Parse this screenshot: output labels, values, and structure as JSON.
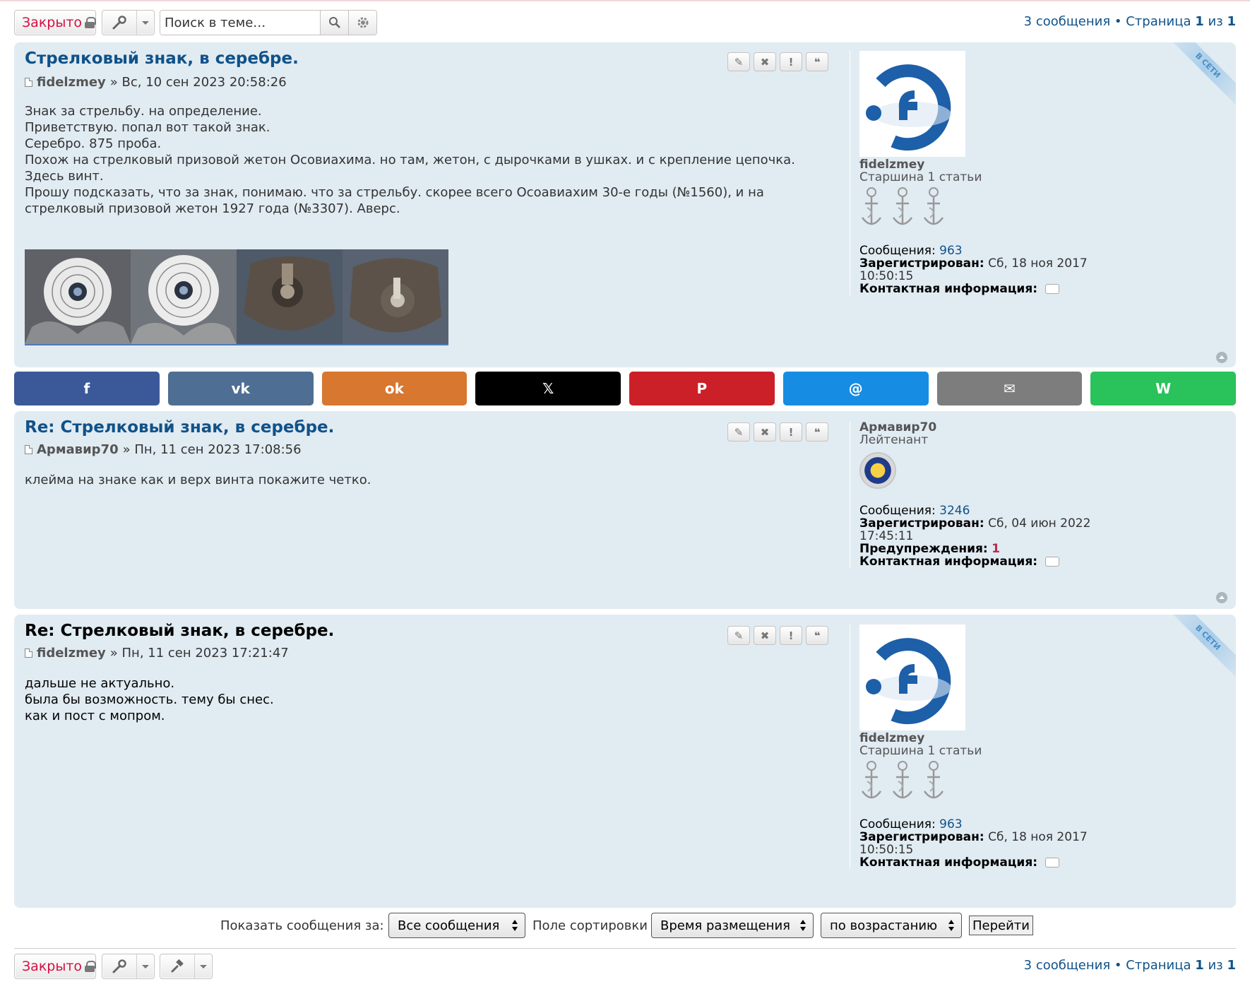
{
  "toolbar": {
    "locked_label": "Закрыто",
    "search_placeholder": "Поиск в теме…",
    "pagination": {
      "count_text": "3 сообщения • Страница ",
      "current": "1",
      "of": " из ",
      "total": "1"
    }
  },
  "posts": [
    {
      "title": "Стрелковый знак, в серебре.",
      "author": "fidelzmey",
      "date": " » Вс, 10 сен 2023 20:58:26",
      "body": [
        "Знак за стрельбу. на определение.",
        "Приветствую. попал вот такой знак.",
        "Серебро. 875 проба.",
        "Похож на стрелковый призовой жетон Осовиахима. но там, жетон, с дырочками в ушках. и с крепление цепочка.",
        "Здесь винт.",
        "Прошу подсказать, что за знак, понимаю. что за стрельбу. скорее всего Осоавиахим 30-е годы (№1560), и на стрелковый призовой жетон 1927 года (№3307). Аверс."
      ],
      "online_ribbon": "В СЕТИ",
      "profile": {
        "username": "fidelzmey",
        "rank": "Старшина 1 статьи",
        "posts_label": "Сообщения:",
        "posts_value": "963",
        "joined_label": "Зарегистрирован:",
        "joined_value": "Сб, 18 ноя 2017 10:50:15",
        "contact_label": "Контактная информация:"
      }
    },
    {
      "title": "Re: Стрелковый знак, в серебре.",
      "author": "Армавир70",
      "date": " » Пн, 11 сен 2023 17:08:56",
      "body": [
        "клейма на знаке как и верх винта покажите четко."
      ],
      "profile": {
        "username": "Армавир70",
        "rank": "Лейтенант",
        "posts_label": "Сообщения:",
        "posts_value": "3246",
        "joined_label": "Зарегистрирован:",
        "joined_value": "Сб, 04 июн 2022 17:45:11",
        "warnings_label": "Предупреждения:",
        "warnings_value": "1",
        "contact_label": "Контактная информация:"
      }
    },
    {
      "title": "Re: Стрелковый знак, в серебре.",
      "author": "fidelzmey",
      "date": " » Пн, 11 сен 2023 17:21:47",
      "body": [
        "дальше не актуально.",
        "была бы возможность. тему бы снес.",
        "как и пост с мопром."
      ],
      "online_ribbon": "В СЕТИ",
      "profile": {
        "username": "fidelzmey",
        "rank": "Старшина 1 статьи",
        "posts_label": "Сообщения:",
        "posts_value": "963",
        "joined_label": "Зарегистрирован:",
        "joined_value": "Сб, 18 ноя 2017 10:50:15",
        "contact_label": "Контактная информация:"
      }
    }
  ],
  "post_buttons": {
    "edit": "✎",
    "delete": "✖",
    "report": "!",
    "quote": "❝"
  },
  "share": [
    {
      "name": "facebook",
      "glyph": "f",
      "color": "#3b5998"
    },
    {
      "name": "vk",
      "glyph": "vk",
      "color": "#4f6e94"
    },
    {
      "name": "odnoklassniki",
      "glyph": "ok",
      "color": "#d77730"
    },
    {
      "name": "x",
      "glyph": "𝕏",
      "color": "#000000"
    },
    {
      "name": "pinterest",
      "glyph": "P",
      "color": "#cb2027"
    },
    {
      "name": "mail",
      "glyph": "@",
      "color": "#168de2"
    },
    {
      "name": "email",
      "glyph": "✉",
      "color": "#7d7d7d"
    },
    {
      "name": "whatsapp",
      "glyph": "W",
      "color": "#29c25b"
    }
  ],
  "sort": {
    "show_label": "Показать сообщения за:",
    "show_value": "Все сообщения",
    "sort_label": "Поле сортировки",
    "sort_value": "Время размещения",
    "dir_value": "по возрастанию",
    "go_label": "Перейти"
  },
  "colors": {
    "link": "#105289",
    "post_bg": "#e1ebf2",
    "locked": "#d31141"
  }
}
